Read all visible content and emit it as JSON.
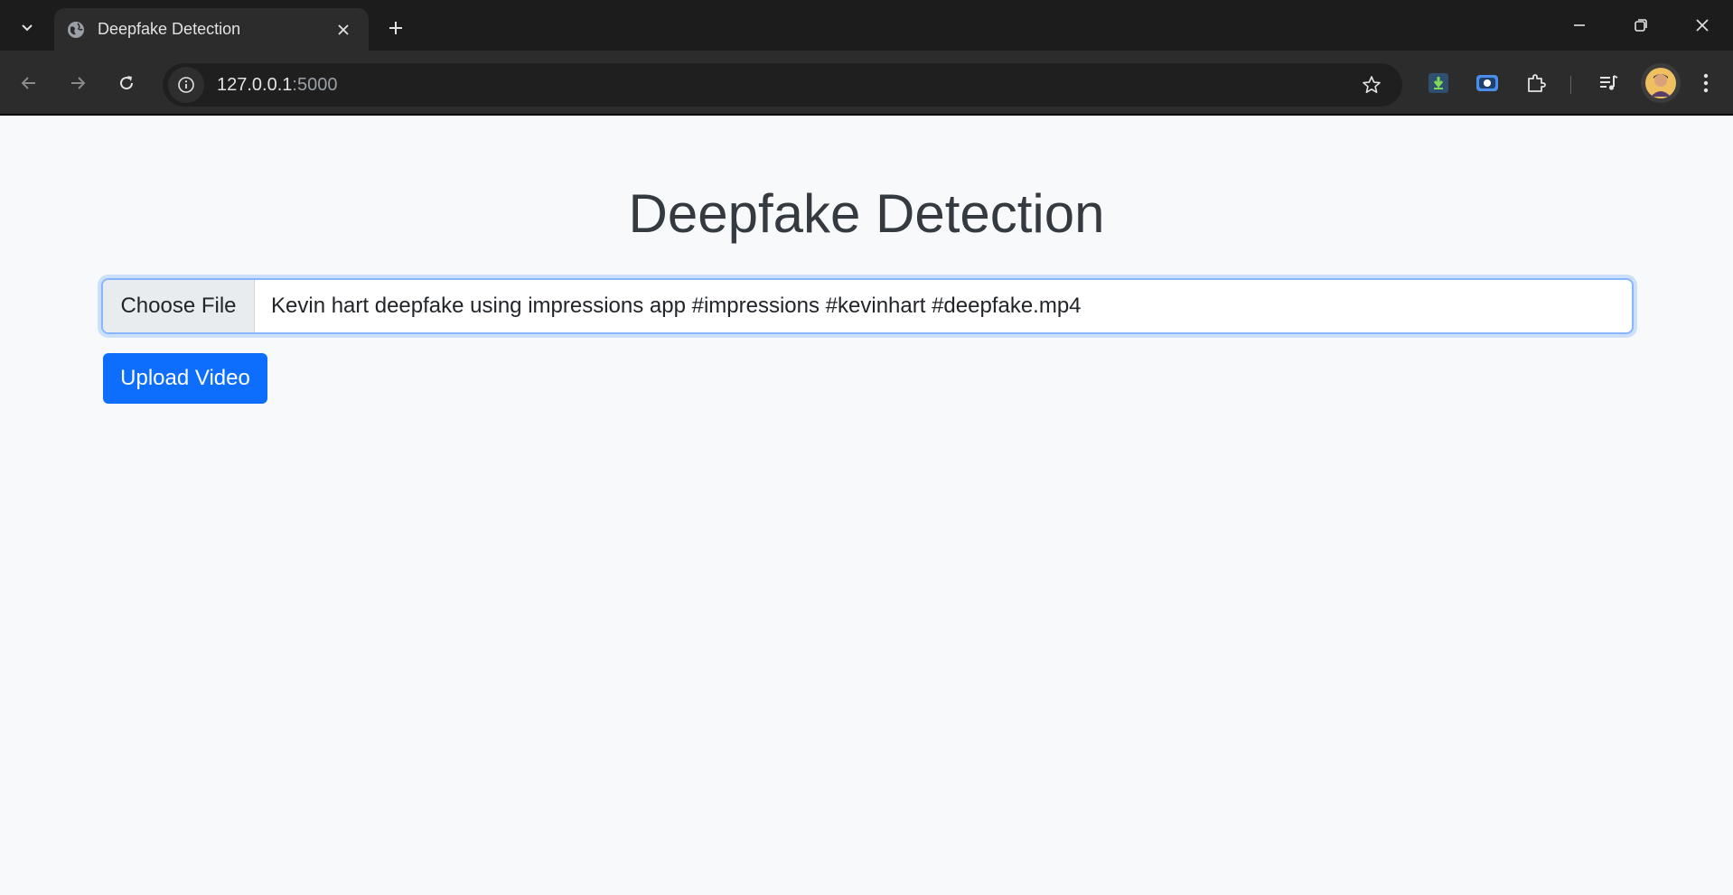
{
  "browser": {
    "tab": {
      "title": "Deepfake Detection",
      "favicon": "globe-icon"
    },
    "address_bar": {
      "host": "127.0.0.1",
      "port": ":5000"
    },
    "icons": {
      "tab_search": "chevron-down-icon",
      "tab_close": "close-icon",
      "new_tab": "plus-icon",
      "minimize": "minimize-icon",
      "restore": "restore-icon",
      "close_window": "close-icon",
      "back": "arrow-left-icon",
      "forward": "arrow-right-icon",
      "reload": "reload-icon",
      "site_info": "info-icon",
      "bookmark": "star-icon",
      "extensions": [
        "download-extension-icon",
        "screen-capture-extension-icon",
        "puzzle-icon",
        "media-queue-icon"
      ],
      "profile": "avatar",
      "menu": "kebab-menu-icon"
    }
  },
  "page": {
    "heading": "Deepfake Detection",
    "file_input": {
      "button_label": "Choose File",
      "selected_file": "Kevin hart deepfake using impressions app #impressions #kevinhart #deepfake.mp4"
    },
    "upload_button": "Upload Video"
  },
  "colors": {
    "primary": "#0d6efd",
    "page_background": "#f8f9fa",
    "heading": "#343a40",
    "focus_border": "#86b7fe",
    "chrome_dark": "#1c1c1c",
    "chrome_toolbar": "#2c2c2c"
  }
}
